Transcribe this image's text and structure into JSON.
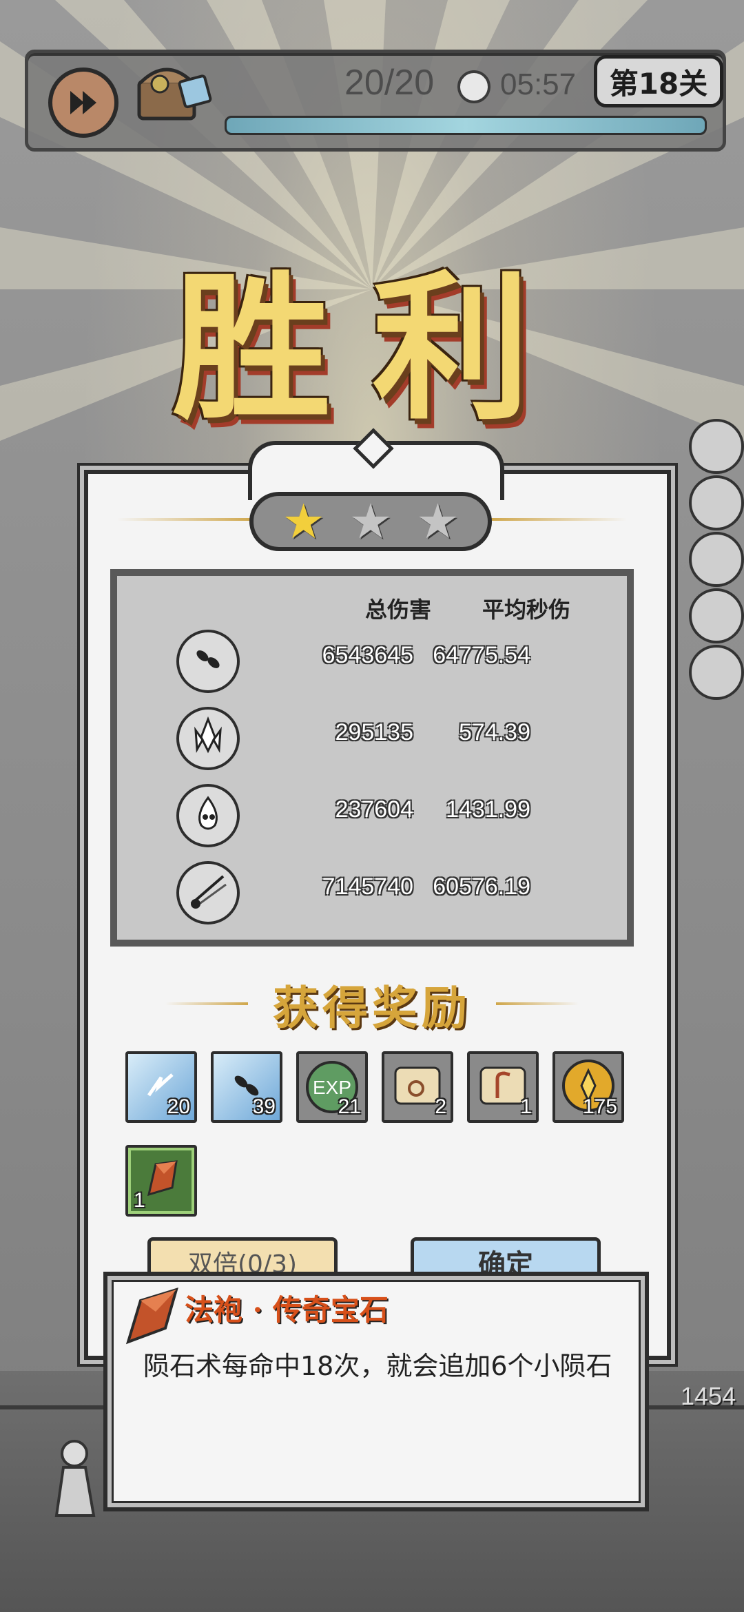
{
  "hud": {
    "wave": "20/20",
    "time": "05:57",
    "level": "第18关",
    "progress": 1.0
  },
  "result": {
    "title": "胜利",
    "stars_earned": 1,
    "stars_total": 3
  },
  "stats": {
    "col_total": "总伤害",
    "col_dps": "平均秒伤",
    "rows": [
      {
        "icon": "meteor-icon",
        "total": "6543645",
        "dps": "64775.54"
      },
      {
        "icon": "ice-crystal-icon",
        "total": "295135",
        "dps": "574.39"
      },
      {
        "icon": "poison-drop-icon",
        "total": "237604",
        "dps": "1431.99"
      },
      {
        "icon": "comet-icon",
        "total": "7145740",
        "dps": "60576.19"
      }
    ]
  },
  "rewards": {
    "title": "获得奖励",
    "items": [
      {
        "icon": "lightning-card-icon",
        "count": "20",
        "color": "#6fa8d8"
      },
      {
        "icon": "meteor-card-icon",
        "count": "39",
        "color": "#6fa8d8"
      },
      {
        "icon": "exp-orb-icon",
        "count": "21",
        "color": "#7a7a7a"
      },
      {
        "icon": "scroll-ring-icon",
        "count": "2",
        "color": "#7a7a7a"
      },
      {
        "icon": "scroll-hook-icon",
        "count": "1",
        "color": "#7a7a7a"
      },
      {
        "icon": "gold-coin-icon",
        "count": "175",
        "color": "#7a7a7a"
      },
      {
        "icon": "legendary-gem-icon",
        "count": "1",
        "color": "#4b7b3b"
      }
    ]
  },
  "buttons": {
    "double": "双倍(0/3)",
    "confirm": "确定"
  },
  "tooltip": {
    "title": "法袍 · 传奇宝石",
    "description": "陨石术每命中18次，就会追加6个小陨石"
  },
  "battlefield": {
    "counter": "1454"
  },
  "colors": {
    "star_on": "#f2cf3c",
    "title_gold": "#f3d873",
    "tooltip_title": "#d7501a"
  }
}
